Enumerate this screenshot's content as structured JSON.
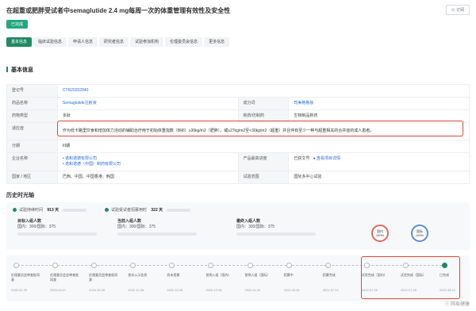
{
  "header": {
    "title": "在超重或肥胖受试者中semaglutide 2.4 mg每周一次的体重管理有效性及安全性",
    "subscribe_label": "订阅",
    "status_badge": "已完成"
  },
  "tabs": [
    "基本信息",
    "临床试验信息",
    "申请人信息",
    "研究者信息",
    "试验参加机构",
    "伦理委员会信息",
    "更多信息"
  ],
  "section_title": "基本信息",
  "info": {
    "reg_no_label": "登记号",
    "reg_no_value": "CTR20202840",
    "drug_label": "药品名称",
    "drug_value": "Semaglutide注射液",
    "drug_class_label": "药物类型",
    "drug_class_value": "多肽",
    "ingredient_label": "成分词",
    "ingredient_value": "司美格鲁肽",
    "sponsor_type_label": "新药/仿制药",
    "sponsor_type_value": "生物制品新药",
    "indication_label": "适应症",
    "indication_value": "作为低卡路里饮食和增加体力活动的辅助治疗用于初始体重指数（BMI）≥30kg/m2（肥胖），或≥27kg/m2至<30kg/m2（超重）并且伴有至少一种与超重相关的合并症的成人患者。",
    "phase_label": "分期",
    "phase_value": "III期",
    "company_label": "企业名称",
    "company_value_1": "• 诺和诺德有限公司",
    "company_value_2": "• 诺和诺德（中国）制药有限公司",
    "product_progress_label": "产品最高进度",
    "product_progress_value": "已获文号",
    "product_progress_link": "查看项目详情",
    "region_label": "国家 / 地区",
    "region_value": "巴西、中国、中国香港、韩国",
    "trial_type_label": "试验范围",
    "trial_type_value": "国际多中心试验"
  },
  "history_title": "历史时光轴",
  "stats": {
    "duration_label": "试验持续时间",
    "duration_value": "913 天",
    "recruit_label": "试验受试者招募用时",
    "recruit_value": "322 天",
    "target_label": "目标入组人数",
    "target_value": "国内：300/国际：375",
    "current_label": "当前入组人数",
    "current_value": "国内：300/国际：375",
    "final_label": "最终入组人数",
    "final_value": "国内：300/国际：375",
    "circle1_label": "国内",
    "circle1_value": "100%",
    "circle2_label": "国际",
    "circle2_value": "100%"
  },
  "timeline": [
    {
      "label": "伦理委员会审查批同意",
      "date": "2020.02.25"
    },
    {
      "label": "伦理委员会会审查批同意",
      "date": "2020.04.21"
    },
    {
      "label": "伦理委员会审查批同意",
      "date": "2020.05.26"
    },
    {
      "label": "首次公示信息",
      "date": "2020.10.28"
    },
    {
      "label": "尚未招募",
      "date": "2020.10.28"
    },
    {
      "label": "首例入组（国内）",
      "date": "2020.12.08"
    },
    {
      "label": "首例入组（国际）",
      "date": "2020.11.04"
    },
    {
      "label": "招募中",
      "date": "2021.03.04"
    },
    {
      "label": "招募完成",
      "date": "2021.07.24"
    },
    {
      "label": "试验完成（国内）",
      "date": "2022.07.25"
    },
    {
      "label": "试验完成（国际）",
      "date": "2022.07.25"
    },
    {
      "label": "已完成",
      "date": "2022.08.12"
    }
  ],
  "watermark": "网易健康"
}
